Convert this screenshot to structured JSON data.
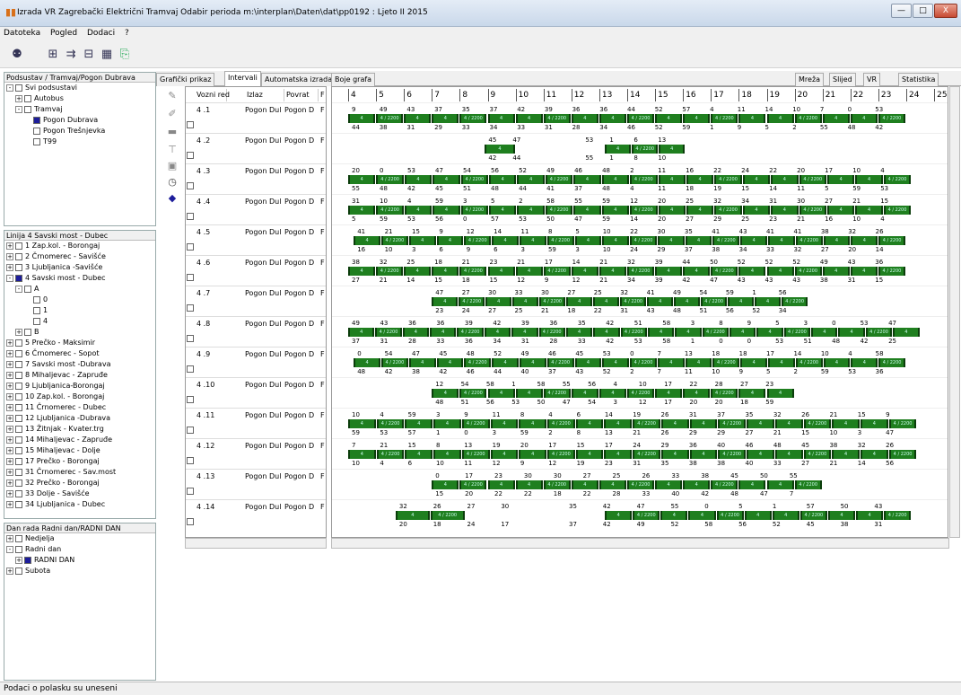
{
  "window": {
    "title": "Izrada VR  Zagrebački Električni Tramvaj Odabir perioda m:\\interplan\\Daten\\dat\\pp0192 : Ljeto II 2015",
    "minimize_label": "—",
    "maximize_label": "□",
    "close_label": "X"
  },
  "menu": [
    "Datoteka",
    "Pogled",
    "Dodaci",
    "?"
  ],
  "panels": {
    "units": {
      "header": "Podsustav / Tramvaj/Pogon Dubrava",
      "items": [
        {
          "label": "Svi podsustavi",
          "level": 0,
          "exp": "-",
          "state": "empty"
        },
        {
          "label": "Autobus",
          "level": 1,
          "exp": "+",
          "state": "empty"
        },
        {
          "label": "Tramvaj",
          "level": 1,
          "exp": "-",
          "state": "empty"
        },
        {
          "label": "Pogon Dubrava",
          "level": 2,
          "exp": "",
          "state": "on"
        },
        {
          "label": "Pogon Trešnjevka",
          "level": 2,
          "exp": "",
          "state": "empty"
        },
        {
          "label": "T99",
          "level": 2,
          "exp": "",
          "state": "empty"
        }
      ]
    },
    "lines": {
      "header": "Linija 4 Savski most - Dubec",
      "items": [
        {
          "label": "1 Zap.kol. - Borongaj",
          "level": 0,
          "exp": "+",
          "state": "empty"
        },
        {
          "label": "2 Črnomerec - Savišće",
          "level": 0,
          "exp": "+",
          "state": "empty"
        },
        {
          "label": "3 Ljubljanica -Savišće",
          "level": 0,
          "exp": "+",
          "state": "empty"
        },
        {
          "label": "4 Savski most - Dubec",
          "level": 0,
          "exp": "-",
          "state": "on"
        },
        {
          "label": "A",
          "level": 1,
          "exp": "-",
          "state": "empty"
        },
        {
          "label": "0",
          "level": 2,
          "exp": "",
          "state": "empty"
        },
        {
          "label": "1",
          "level": 2,
          "exp": "",
          "state": "empty"
        },
        {
          "label": "4",
          "level": 2,
          "exp": "",
          "state": "empty"
        },
        {
          "label": "B",
          "level": 1,
          "exp": "+",
          "state": "empty"
        },
        {
          "label": "5 Prečko - Maksimir",
          "level": 0,
          "exp": "+",
          "state": "empty"
        },
        {
          "label": "6 Črnomerec - Sopot",
          "level": 0,
          "exp": "+",
          "state": "empty"
        },
        {
          "label": "7 Savski most -Dubrava",
          "level": 0,
          "exp": "+",
          "state": "empty"
        },
        {
          "label": "8 Mihaljevac - Zapruđe",
          "level": 0,
          "exp": "+",
          "state": "empty"
        },
        {
          "label": "9 Ljubljanica-Borongaj",
          "level": 0,
          "exp": "+",
          "state": "empty"
        },
        {
          "label": "10 Zap.kol. - Borongaj",
          "level": 0,
          "exp": "+",
          "state": "empty"
        },
        {
          "label": "11 Črnomerec - Dubec",
          "level": 0,
          "exp": "+",
          "state": "empty"
        },
        {
          "label": "12 Ljubljanica -Dubrava",
          "level": 0,
          "exp": "+",
          "state": "empty"
        },
        {
          "label": "13 Žitnjak - Kvater.trg",
          "level": 0,
          "exp": "+",
          "state": "empty"
        },
        {
          "label": "14 Mihaljevac - Zapruđe",
          "level": 0,
          "exp": "+",
          "state": "empty"
        },
        {
          "label": "15 Mihaljevac - Dolje",
          "level": 0,
          "exp": "+",
          "state": "empty"
        },
        {
          "label": "17 Prečko - Borongaj",
          "level": 0,
          "exp": "+",
          "state": "empty"
        },
        {
          "label": "31 Črnomerec - Sav.most",
          "level": 0,
          "exp": "+",
          "state": "empty"
        },
        {
          "label": "32 Prečko - Borongaj",
          "level": 0,
          "exp": "+",
          "state": "empty"
        },
        {
          "label": "33 Dolje - Savišće",
          "level": 0,
          "exp": "+",
          "state": "empty"
        },
        {
          "label": "34 Ljubljanica - Dubec",
          "level": 0,
          "exp": "+",
          "state": "empty"
        }
      ]
    },
    "days": {
      "header": "Dan rada Radni dan/RADNI DAN",
      "items": [
        {
          "label": "Nedjelja",
          "level": 0,
          "exp": "+",
          "state": "empty"
        },
        {
          "label": "Radni dan",
          "level": 0,
          "exp": "-",
          "state": "empty"
        },
        {
          "label": "RADNI DAN",
          "level": 1,
          "exp": "+",
          "state": "on"
        },
        {
          "label": "Subota",
          "level": 0,
          "exp": "+",
          "state": "empty"
        }
      ]
    }
  },
  "tabs": [
    "Grafički prikaz",
    "Intervali",
    "Automatska izrada",
    "Boje grafa"
  ],
  "active_tab": "Intervali",
  "right_tabs": [
    "Mreža",
    "Slijed",
    "VR",
    "Statistika"
  ],
  "grid": {
    "headers": [
      "Vozni red",
      "Izlaz",
      "Povrat",
      "F"
    ],
    "izlaz": "Pogon Dul",
    "povrat": "Pogon D",
    "f": "F",
    "rows": [
      "4 .1",
      "4 .2",
      "4 .3",
      "4 .4",
      "4 .5",
      "4 .6",
      "4 .7",
      "4 .8",
      "4 .9",
      "4 .10",
      "4 .11",
      "4 .12",
      "4 .13",
      "4 .14"
    ]
  },
  "timeline": {
    "hours": [
      "4",
      "5",
      "6",
      "7",
      "8",
      "9",
      "10",
      "11",
      "12",
      "13",
      "14",
      "15",
      "16",
      "17",
      "18",
      "19",
      "20",
      "21",
      "22",
      "23",
      "24",
      "25"
    ],
    "seg_label_a": "4",
    "seg_label_b": "4 / 2200",
    "rows": [
      {
        "start": 4.0,
        "end": 24.0,
        "gaps": [],
        "top": [
          "9",
          "49",
          "43",
          "37",
          "35",
          "37",
          "42",
          "39",
          "36",
          "36",
          "44",
          "52",
          "57",
          "4",
          "11",
          "14",
          "10",
          "7",
          "0",
          "53"
        ],
        "bot": [
          "44",
          "38",
          "31",
          "29",
          "33",
          "34",
          "33",
          "31",
          "28",
          "34",
          "46",
          "52",
          "59",
          "1",
          "9",
          "5",
          "2",
          "55",
          "48",
          "42"
        ]
      },
      {
        "start": 8.9,
        "end": 10.0,
        "gaps": [],
        "seg2": [
          13.2,
          16.1
        ],
        "top": [
          "45",
          "47",
          "",
          "",
          "53",
          "1",
          "6",
          "13"
        ],
        "bot": [
          "42",
          "44",
          "",
          "",
          "55",
          "1",
          "8",
          "10"
        ]
      },
      {
        "start": 4.0,
        "end": 24.2,
        "gaps": [],
        "top": [
          "20",
          "0",
          "53",
          "47",
          "54",
          "56",
          "52",
          "49",
          "46",
          "48",
          "2",
          "11",
          "16",
          "22",
          "24",
          "22",
          "20",
          "17",
          "10",
          "4"
        ],
        "bot": [
          "55",
          "48",
          "42",
          "45",
          "51",
          "48",
          "44",
          "41",
          "37",
          "48",
          "4",
          "11",
          "18",
          "19",
          "15",
          "14",
          "11",
          "5",
          "59",
          "53"
        ]
      },
      {
        "start": 4.0,
        "end": 24.2,
        "gaps": [],
        "top": [
          "31",
          "10",
          "4",
          "59",
          "3",
          "5",
          "2",
          "58",
          "55",
          "59",
          "12",
          "20",
          "25",
          "32",
          "34",
          "31",
          "30",
          "27",
          "21",
          "15"
        ],
        "bot": [
          "5",
          "59",
          "53",
          "56",
          "0",
          "57",
          "53",
          "50",
          "47",
          "59",
          "14",
          "20",
          "27",
          "29",
          "25",
          "23",
          "21",
          "16",
          "10",
          "4"
        ]
      },
      {
        "start": 4.2,
        "end": 24.0,
        "gaps": [],
        "top": [
          "41",
          "21",
          "15",
          "9",
          "12",
          "14",
          "11",
          "8",
          "5",
          "10",
          "22",
          "30",
          "35",
          "41",
          "43",
          "41",
          "41",
          "38",
          "32",
          "26"
        ],
        "bot": [
          "16",
          "10",
          "3",
          "6",
          "9",
          "6",
          "3",
          "59",
          "3",
          "10",
          "24",
          "29",
          "37",
          "38",
          "34",
          "33",
          "32",
          "27",
          "20",
          "14"
        ]
      },
      {
        "start": 4.0,
        "end": 24.0,
        "gaps": [],
        "top": [
          "38",
          "32",
          "25",
          "18",
          "21",
          "23",
          "21",
          "17",
          "14",
          "21",
          "32",
          "39",
          "44",
          "50",
          "52",
          "52",
          "52",
          "49",
          "43",
          "36"
        ],
        "bot": [
          "27",
          "21",
          "14",
          "15",
          "18",
          "15",
          "12",
          "9",
          "12",
          "21",
          "34",
          "39",
          "42",
          "47",
          "43",
          "43",
          "43",
          "38",
          "31",
          "15"
        ]
      },
      {
        "start": 7.0,
        "end": 20.5,
        "gaps": [],
        "top": [
          "47",
          "27",
          "30",
          "33",
          "30",
          "27",
          "25",
          "32",
          "41",
          "49",
          "54",
          "59",
          "1",
          "56"
        ],
        "bot": [
          "23",
          "24",
          "27",
          "25",
          "21",
          "18",
          "22",
          "31",
          "43",
          "48",
          "51",
          "56",
          "52",
          "34"
        ]
      },
      {
        "start": 4.0,
        "end": 24.5,
        "gaps": [],
        "top": [
          "49",
          "43",
          "36",
          "36",
          "39",
          "42",
          "39",
          "36",
          "35",
          "42",
          "51",
          "58",
          "3",
          "8",
          "9",
          "5",
          "3",
          "0",
          "53",
          "47"
        ],
        "bot": [
          "37",
          "31",
          "28",
          "33",
          "36",
          "34",
          "31",
          "28",
          "33",
          "42",
          "53",
          "58",
          "1",
          "0",
          "0",
          "53",
          "51",
          "48",
          "42",
          "25"
        ]
      },
      {
        "start": 4.2,
        "end": 24.0,
        "gaps": [],
        "top": [
          "0",
          "54",
          "47",
          "45",
          "48",
          "52",
          "49",
          "46",
          "45",
          "53",
          "0",
          "7",
          "13",
          "18",
          "18",
          "17",
          "14",
          "10",
          "4",
          "58"
        ],
        "bot": [
          "48",
          "42",
          "38",
          "42",
          "46",
          "44",
          "40",
          "37",
          "43",
          "52",
          "2",
          "7",
          "11",
          "10",
          "9",
          "5",
          "2",
          "59",
          "53",
          "36"
        ]
      },
      {
        "start": 7.0,
        "end": 20.0,
        "gaps": [],
        "top": [
          "12",
          "54",
          "58",
          "1",
          "58",
          "55",
          "56",
          "4",
          "10",
          "17",
          "22",
          "28",
          "27",
          "23"
        ],
        "bot": [
          "48",
          "51",
          "56",
          "53",
          "50",
          "47",
          "54",
          "3",
          "12",
          "17",
          "20",
          "20",
          "18",
          "59"
        ]
      },
      {
        "start": 4.0,
        "end": 24.4,
        "gaps": [],
        "top": [
          "10",
          "4",
          "59",
          "3",
          "9",
          "11",
          "8",
          "4",
          "6",
          "14",
          "19",
          "26",
          "31",
          "37",
          "35",
          "32",
          "26",
          "21",
          "15",
          "9"
        ],
        "bot": [
          "59",
          "53",
          "57",
          "1",
          "0",
          "3",
          "59",
          "2",
          "8",
          "13",
          "21",
          "26",
          "29",
          "29",
          "27",
          "21",
          "15",
          "10",
          "3",
          "47"
        ]
      },
      {
        "start": 4.0,
        "end": 24.4,
        "gaps": [],
        "top": [
          "7",
          "21",
          "15",
          "8",
          "13",
          "19",
          "20",
          "17",
          "15",
          "17",
          "24",
          "29",
          "36",
          "40",
          "46",
          "48",
          "45",
          "38",
          "32",
          "26"
        ],
        "bot": [
          "10",
          "4",
          "6",
          "10",
          "11",
          "12",
          "9",
          "12",
          "19",
          "23",
          "31",
          "35",
          "38",
          "38",
          "40",
          "33",
          "27",
          "21",
          "14",
          "56"
        ]
      },
      {
        "start": 7.0,
        "end": 21.0,
        "gaps": [],
        "top": [
          "0",
          "17",
          "23",
          "30",
          "30",
          "27",
          "25",
          "26",
          "33",
          "38",
          "45",
          "50",
          "55"
        ],
        "bot": [
          "15",
          "20",
          "22",
          "22",
          "18",
          "22",
          "28",
          "33",
          "40",
          "42",
          "48",
          "47",
          "7"
        ]
      },
      {
        "start": 5.7,
        "end": 8.2,
        "gaps": [],
        "seg2": [
          13.2,
          24.2
        ],
        "top": [
          "32",
          "26",
          "27",
          "30",
          "",
          "35",
          "42",
          "47",
          "55",
          "0",
          "5",
          "1",
          "57",
          "50",
          "43"
        ],
        "bot": [
          "20",
          "18",
          "24",
          "17",
          "",
          "37",
          "42",
          "49",
          "52",
          "58",
          "56",
          "52",
          "45",
          "38",
          "31"
        ]
      }
    ]
  },
  "status": "Podaci o polasku su uneseni",
  "colors": {
    "accent": "#1f7f1f",
    "selected": "#1d1d9b"
  }
}
